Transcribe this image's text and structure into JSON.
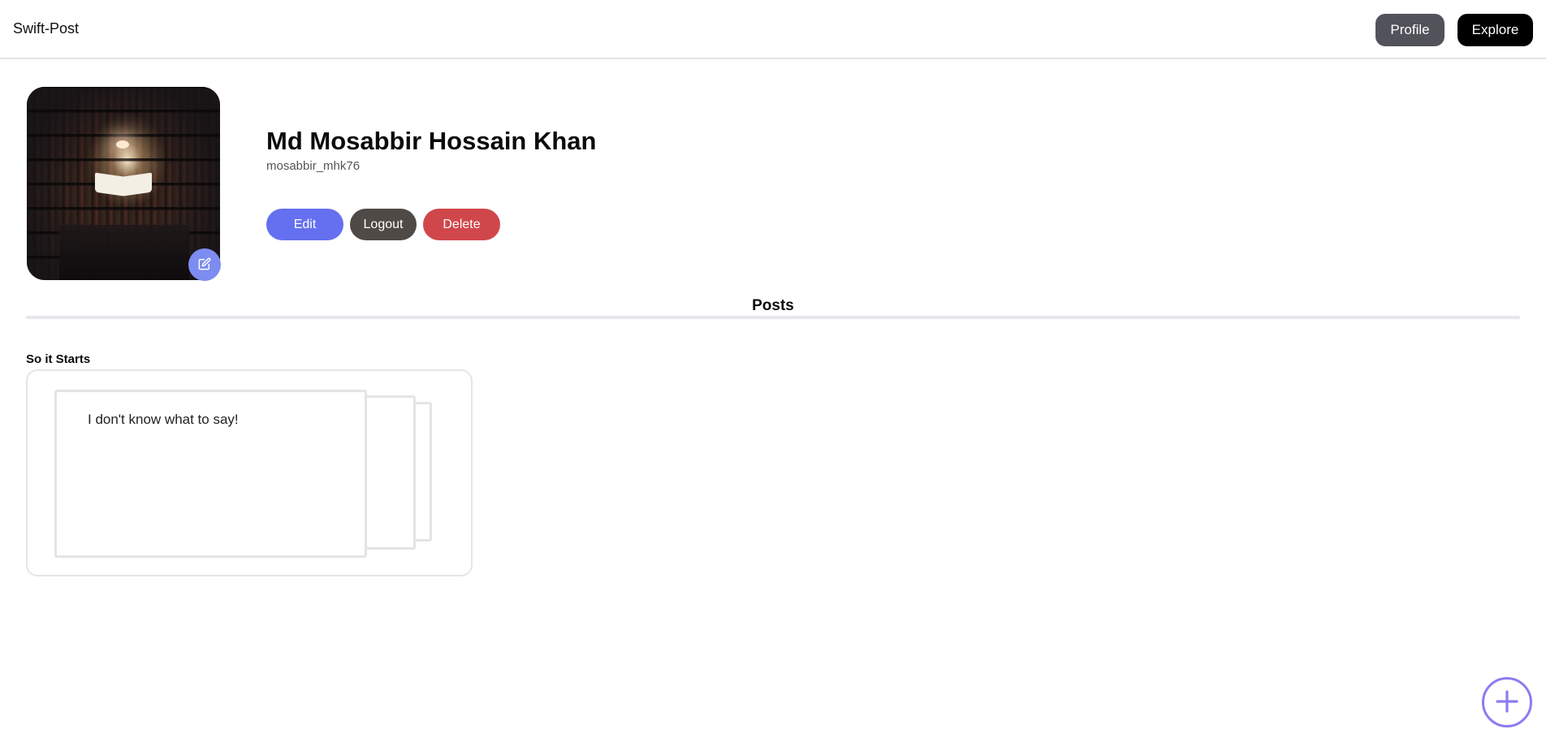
{
  "header": {
    "brand": "Swift-Post",
    "nav": {
      "profile_label": "Profile",
      "explore_label": "Explore"
    }
  },
  "profile": {
    "name": "Md Mosabbir Hossain Khan",
    "username": "mosabbir_mhk76",
    "avatar_icon": "library-photo",
    "edit_photo_icon": "edit-icon",
    "actions": {
      "edit_label": "Edit",
      "logout_label": "Logout",
      "delete_label": "Delete"
    }
  },
  "posts": {
    "heading": "Posts",
    "items": [
      {
        "title": "So it Starts",
        "body": "I don't know what to say!"
      }
    ]
  },
  "fab": {
    "icon": "plus-icon"
  },
  "colors": {
    "profile_button": "#52525b",
    "explore_button": "#000000",
    "edit_button": "#6470ef",
    "logout_button": "#4f4a45",
    "delete_button": "#d0474b",
    "fab_accent": "#8b7cf0"
  }
}
